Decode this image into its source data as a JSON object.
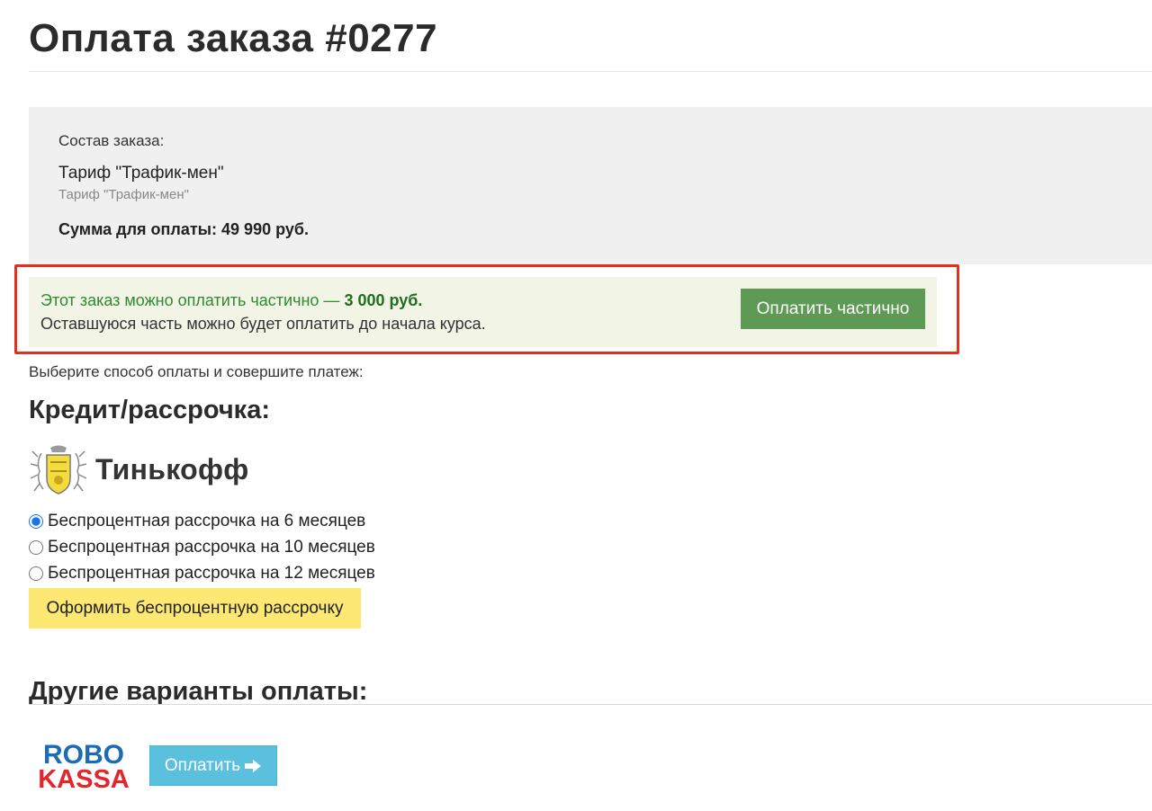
{
  "page": {
    "title": "Оплата заказа #0277"
  },
  "order": {
    "label": "Состав заказа:",
    "item_name": "Тариф \"Трафик-мен\"",
    "item_sub": "Тариф \"Трафик-мен\"",
    "sum": "Сумма для оплаты: 49 990 руб."
  },
  "partial": {
    "text_prefix": "Этот заказ можно оплатить частично — ",
    "amount": "3 000 руб.",
    "text_rest": "Оставшуюся часть можно будет оплатить до начала курса.",
    "button_label": "Оплатить частично"
  },
  "choose_text": "Выберите способ оплаты и совершите платеж:",
  "credit": {
    "heading": "Кредит/рассрочка:",
    "bank_name": "Тинькофф",
    "options": [
      {
        "label": "Беспроцентная рассрочка на 6 месяцев",
        "checked": true
      },
      {
        "label": "Беспроцентная рассрочка на 10 месяцев",
        "checked": false
      },
      {
        "label": "Беспроцентная рассрочка на 12 месяцев",
        "checked": false
      }
    ],
    "button_label": "Оформить беспроцентную рассрочку"
  },
  "other": {
    "heading": "Другие варианты оплаты:",
    "robokassa_line1": "ROBO",
    "robokassa_line2": "KASSA",
    "pay_label": "Оплатить",
    "pay_icon": "arrow-right-icon"
  },
  "colors": {
    "partial_bg": "#f2f5e6",
    "partial_button": "#5e9a55",
    "installment_button": "#fde874",
    "pay_button": "#5bc0de",
    "highlight_frame": "#e0301e",
    "robokassa_blue": "#1c6bb5",
    "robokassa_red": "#e2262c"
  }
}
